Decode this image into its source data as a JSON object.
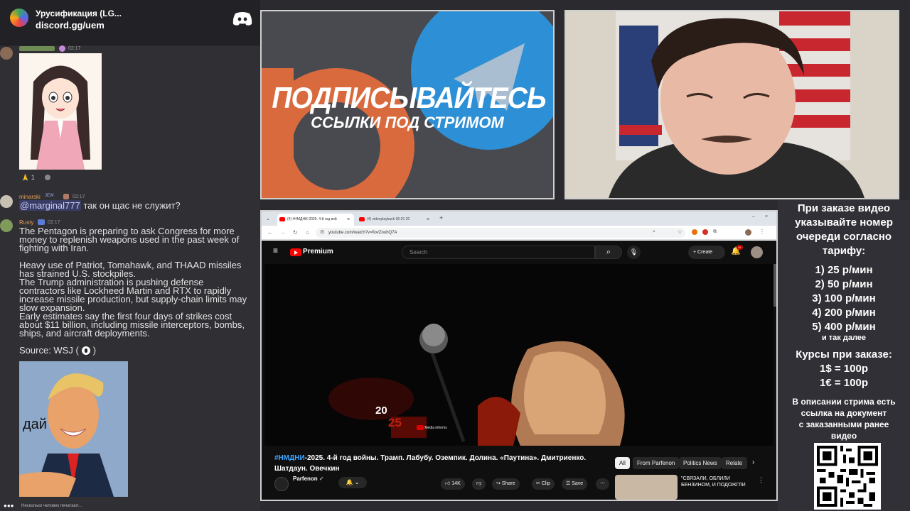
{
  "discord": {
    "server_name": "Урусификация (LG...",
    "invite": "discord.gg/uem",
    "msg1": {
      "time": "02:17",
      "reaction_count": "1"
    },
    "msg2": {
      "user": "minarski",
      "badge": "JEW",
      "time": "02:17",
      "mention": "@marginal777",
      "text": "так он щас не служит?"
    },
    "msg3": {
      "user": "Rusty",
      "time": "02:17",
      "para1": [
        "The Pentagon is preparing to ask Congress for more",
        "money to replenish weapons used in the past week of",
        "fighting with Iran."
      ],
      "para2": [
        "Heavy use of Patriot, Tomahawk, and THAAD missiles",
        "has strained U.S. stockpiles.",
        "The Trump administration is pushing defense",
        "contractors like Lockheed Martin and RTX to rapidly",
        "increase missile production, but supply-chain limits may",
        "slow expansion.",
        "Early estimates say the first four days of strikes cost",
        "about $11 billion, including missile interceptors, bombs,",
        "ships, and aircraft deployments."
      ],
      "source": "Source: WSJ (",
      "source_end": ")",
      "image_caption": "дай"
    },
    "typing": "Несколько человек печатают..."
  },
  "banner": {
    "title": "ПОДПИСЫВАЙТЕСЬ",
    "subtitle": "ССЫЛКИ ПОД СТРИМОМ"
  },
  "browser": {
    "tab1": "(4) #НМДНИ-2025. 4-й год вой",
    "tab2": "(4) videoplayback 06-01 20",
    "url": "youtube.com/watch?v=flovZouhQ7A",
    "yt": {
      "logo": "Premium",
      "search_placeholder": "Search",
      "create": "Create",
      "notif_count": "9+",
      "video_overlay": "20",
      "video_overlay2": "25",
      "video_watermark": "Media informs",
      "title_hashtag": "#НМДНИ",
      "title_line1": "-2025. 4-й год войны. Трамп. Лабубу. Оземпик. Долина. «Паутина». Дмитриенко.",
      "title_line2": "Шатдаун. Овечкин",
      "channel": "Parfenon",
      "chips": [
        "All",
        "From Parfenon",
        "Politics News",
        "Relate"
      ],
      "likes": "14K",
      "share": "Share",
      "clip": "Clip",
      "save": "Save",
      "rec_title": "\"СВЯЗАЛИ, ОБЛИЛИ БЕНЗИНОМ, И ПОДОЖГЛИ"
    }
  },
  "sidebar": {
    "intro": [
      "При заказе видео",
      "указывайте номер",
      "очереди согласно",
      "тарифу:"
    ],
    "prices": [
      "1) 25 р/мин",
      "2) 50 р/мин",
      "3) 100 р/мин",
      "4) 200 р/мин",
      "5) 400 р/мин"
    ],
    "etc": "и так далее",
    "rates_title": "Курсы при заказе:",
    "rates": [
      "1$ = 100р",
      "1€ = 100р"
    ],
    "desc": [
      "В описании стрима есть",
      "ссылка на документ",
      "с заказанными ранее",
      "видео"
    ]
  }
}
